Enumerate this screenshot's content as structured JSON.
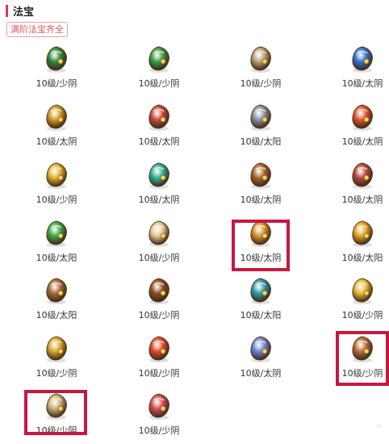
{
  "section": {
    "title": "法宝",
    "badge": "满阶法宝齐全"
  },
  "items": [
    {
      "label": "10级/少阴",
      "icon": "green-umbrella-icon",
      "color": "#2f8a3c"
    },
    {
      "label": "10级/少阴",
      "icon": "gourd-icon",
      "color": "#3b9a4a"
    },
    {
      "label": "10级/少阴",
      "icon": "scroll-book-icon",
      "color": "#b8a27a"
    },
    {
      "label": "10级/太阴",
      "icon": "blue-gem-icon",
      "color": "#2e74d6"
    },
    {
      "label": "10级/太阴",
      "icon": "golden-rope-icon",
      "color": "#d19a2a"
    },
    {
      "label": "10级/太阴",
      "icon": "pagoda-statue-icon",
      "color": "#c7483a"
    },
    {
      "label": "10级/太阳",
      "icon": "lantern-tower-icon",
      "color": "#8a8fa6"
    },
    {
      "label": "10级/太阴",
      "icon": "fire-sword-icon",
      "color": "#e0522e"
    },
    {
      "label": "10级/少阴",
      "icon": "gold-pagoda-icon",
      "color": "#e3b32e"
    },
    {
      "label": "10级/太阴",
      "icon": "jade-dragon-icon",
      "color": "#2ab39a"
    },
    {
      "label": "10级/太阴",
      "icon": "bronze-mask-icon",
      "color": "#a5642a"
    },
    {
      "label": "10级/太阴",
      "icon": "red-chest-icon",
      "color": "#b5473a"
    },
    {
      "label": "10级/太阳",
      "icon": "green-dragon-icon",
      "color": "#3aa84a"
    },
    {
      "label": "10级/少阴",
      "icon": "talisman-paper-icon",
      "color": "#e2c79a"
    },
    {
      "label": "10级/太阴",
      "icon": "golden-gourd-bag-icon",
      "color": "#d8902a"
    },
    {
      "label": "10级/太阳",
      "icon": "fan-scarf-icon",
      "color": "#e1a224"
    },
    {
      "label": "10级/太阳",
      "icon": "wooden-puppet-icon",
      "color": "#a6683a"
    },
    {
      "label": "10级/少阴",
      "icon": "crossbow-icon",
      "color": "#8b4a2a"
    },
    {
      "label": "10级/太阳",
      "icon": "teal-cloud-icon",
      "color": "#2a9aa8"
    },
    {
      "label": "10级/少阴",
      "icon": "golden-bell-rod-icon",
      "color": "#e8b636"
    },
    {
      "label": "10级/少阴",
      "icon": "bronze-bell-icon",
      "color": "#d8a72e"
    },
    {
      "label": "10级/少阴",
      "icon": "fire-orb-icon",
      "color": "#e54a2a"
    },
    {
      "label": "10级/太阴",
      "icon": "ice-crystal-icon",
      "color": "#6b86d8"
    },
    {
      "label": "10级/少阴",
      "icon": "scroll-bundle-icon",
      "color": "#b86a3a"
    },
    {
      "label": "10级/少阴",
      "icon": "crossed-swords-icon",
      "color": "#c9b27a"
    },
    {
      "label": "10级/少阴",
      "icon": "red-beads-icon",
      "color": "#d84a5a"
    }
  ],
  "watermark": "✧"
}
